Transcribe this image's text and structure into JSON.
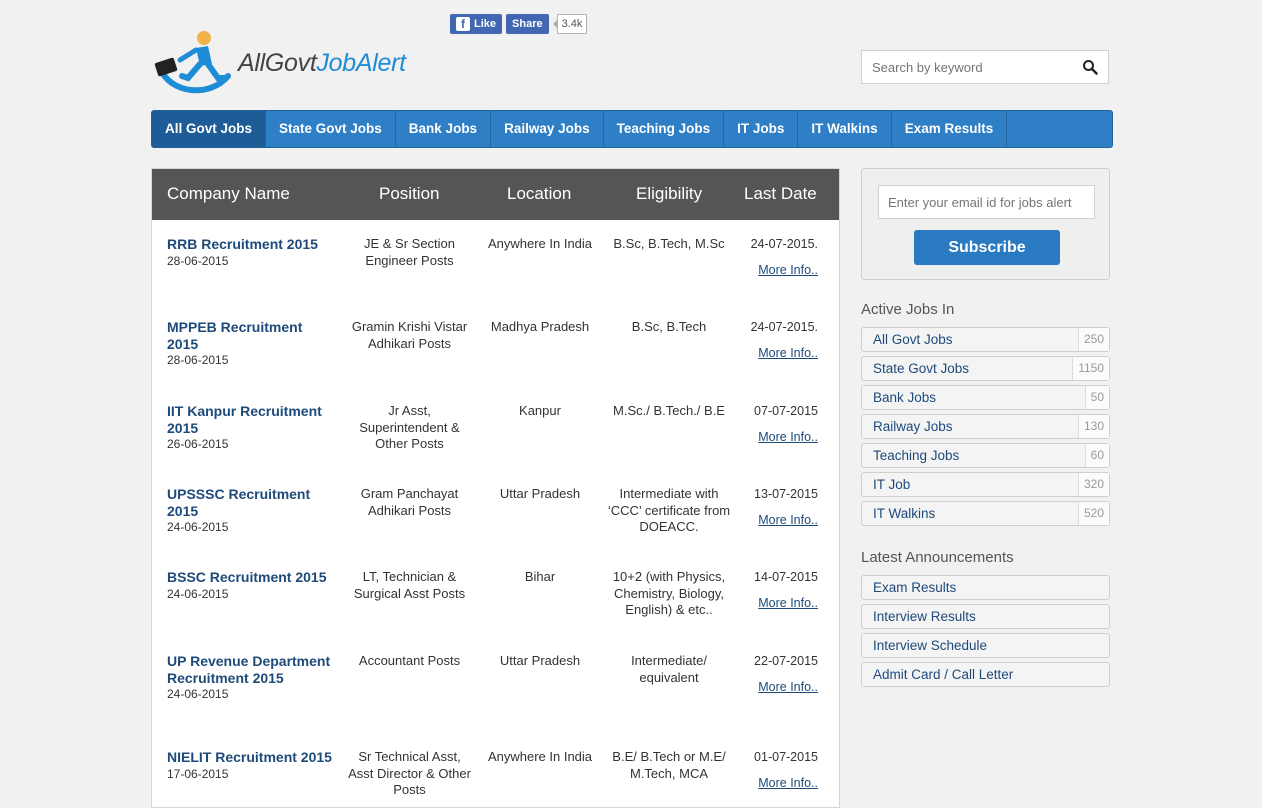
{
  "facebook": {
    "like_label": "Like",
    "share_label": "Share",
    "count": "3.4k"
  },
  "logo": {
    "part1": "AllGovt",
    "part2": "JobAlert"
  },
  "search": {
    "placeholder": "Search by keyword"
  },
  "nav": [
    {
      "label": "All Govt Jobs"
    },
    {
      "label": "State Govt Jobs"
    },
    {
      "label": "Bank Jobs"
    },
    {
      "label": "Railway Jobs"
    },
    {
      "label": "Teaching Jobs"
    },
    {
      "label": "IT Jobs"
    },
    {
      "label": "IT Walkins"
    },
    {
      "label": "Exam Results"
    }
  ],
  "table": {
    "headers": {
      "company": "Company Name",
      "position": "Position",
      "location": "Location",
      "eligibility": "Eligibility",
      "last_date": "Last Date"
    },
    "more_label": "More Info..",
    "rows": [
      {
        "company": "RRB Recruitment 2015",
        "date": "28-06-2015",
        "position": "JE & Sr Section Engineer Posts",
        "location": "Anywhere In India",
        "eligibility": "B.Sc, B.Tech, M.Sc",
        "last_date": "24-07-2015."
      },
      {
        "company": "MPPEB Recruitment 2015",
        "date": "28-06-2015",
        "position": "Gramin Krishi Vistar Adhikari Posts",
        "location": "Madhya Pradesh",
        "eligibility": "B.Sc, B.Tech",
        "last_date": "24-07-2015."
      },
      {
        "company": "IIT Kanpur Recruitment 2015",
        "date": "26-06-2015",
        "position": "Jr Asst, Superintendent & Other Posts",
        "location": "Kanpur",
        "eligibility": "M.Sc./ B.Tech./ B.E",
        "last_date": "07-07-2015"
      },
      {
        "company": "UPSSSC Recruitment 2015",
        "date": "24-06-2015",
        "position": "Gram Panchayat Adhikari Posts",
        "location": "Uttar Pradesh",
        "eligibility": "Intermediate with ‘CCC’ certificate from DOEACC.",
        "last_date": "13-07-2015"
      },
      {
        "company": "BSSC Recruitment 2015",
        "date": "24-06-2015",
        "position": "LT, Technician & Surgical Asst Posts",
        "location": "Bihar",
        "eligibility": "10+2 (with Physics, Chemistry, Biology, English) & etc..",
        "last_date": "14-07-2015"
      },
      {
        "company": "UP Revenue Department Recruitment 2015",
        "date": "24-06-2015",
        "position": "Accountant Posts",
        "location": "Uttar Pradesh",
        "eligibility": "Intermediate/ equivalent",
        "last_date": "22-07-2015"
      },
      {
        "company": "NIELIT Recruitment 2015",
        "date": "17-06-2015",
        "position": "Sr Technical Asst, Asst Director & Other Posts",
        "location": "Anywhere In India",
        "eligibility": "B.E/ B.Tech or M.E/ M.Tech, MCA",
        "last_date": "01-07-2015"
      }
    ]
  },
  "subscribe": {
    "placeholder": "Enter your email id for jobs alert",
    "button_label": "Subscribe"
  },
  "active_jobs": {
    "heading": "Active Jobs In",
    "items": [
      {
        "label": "All Govt Jobs",
        "count": "250"
      },
      {
        "label": "State Govt Jobs",
        "count": "1150"
      },
      {
        "label": "Bank Jobs",
        "count": "50"
      },
      {
        "label": "Railway Jobs",
        "count": "130"
      },
      {
        "label": "Teaching Jobs",
        "count": "60"
      },
      {
        "label": "IT Job",
        "count": "320"
      },
      {
        "label": "IT Walkins",
        "count": "520"
      }
    ]
  },
  "announcements": {
    "heading": "Latest Announcements",
    "items": [
      {
        "label": "Exam Results"
      },
      {
        "label": "Interview Results"
      },
      {
        "label": "Interview Schedule"
      },
      {
        "label": "Admit Card / Call Letter"
      }
    ]
  },
  "colors": {
    "nav_bg": "#2e7fc6",
    "nav_active": "#1d5c96",
    "link": "#1e4a7a",
    "header_bg": "#555555",
    "logo_blue": "#1f8cd6"
  }
}
